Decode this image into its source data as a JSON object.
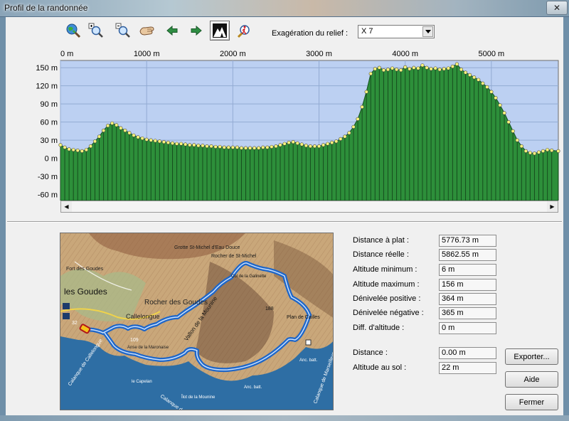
{
  "window": {
    "title": "Profil de la randonnée",
    "close_glyph": "✕"
  },
  "toolbar": {
    "icons": [
      "globe-search-icon",
      "zoom-in-icon",
      "zoom-out-icon",
      "hand-pan-icon",
      "arrow-left-icon",
      "arrow-right-icon",
      "terrain-icon",
      "hiker-icon"
    ],
    "exaggeration_label": "Exagération du relief :",
    "exaggeration_value": "X 7"
  },
  "chart_data": {
    "type": "area",
    "x_unit": "m",
    "x_ticks": [
      "0 m",
      "1000 m",
      "2000 m",
      "3000 m",
      "4000 m",
      "5000 m"
    ],
    "y_ticks": [
      "150 m",
      "120 m",
      "90 m",
      "60 m",
      "30 m",
      "0 m",
      "-30 m",
      "-60 m"
    ],
    "xlim": [
      0,
      5776.73
    ],
    "ylim": [
      -70,
      162
    ],
    "grid": true,
    "fill_color": "#2d8f3a",
    "point_color": "#fbf57c",
    "plot_background": "#bcd0f2",
    "distance_m": [
      0,
      50,
      100,
      150,
      200,
      250,
      300,
      350,
      400,
      450,
      500,
      550,
      600,
      650,
      700,
      750,
      800,
      850,
      900,
      950,
      1000,
      1050,
      1100,
      1150,
      1200,
      1250,
      1300,
      1350,
      1400,
      1450,
      1500,
      1550,
      1600,
      1650,
      1700,
      1750,
      1800,
      1850,
      1900,
      1950,
      2000,
      2050,
      2100,
      2150,
      2200,
      2250,
      2300,
      2350,
      2400,
      2450,
      2500,
      2550,
      2600,
      2650,
      2700,
      2750,
      2800,
      2850,
      2900,
      2950,
      3000,
      3050,
      3100,
      3150,
      3200,
      3250,
      3300,
      3350,
      3400,
      3450,
      3500,
      3550,
      3600,
      3650,
      3700,
      3750,
      3800,
      3850,
      3900,
      3950,
      4000,
      4050,
      4100,
      4150,
      4200,
      4250,
      4300,
      4350,
      4400,
      4450,
      4500,
      4550,
      4600,
      4650,
      4700,
      4750,
      4800,
      4850,
      4900,
      4950,
      5000,
      5050,
      5100,
      5150,
      5200,
      5250,
      5300,
      5350,
      5400,
      5450,
      5500,
      5550,
      5600,
      5650,
      5700,
      5776
    ],
    "altitude_m": [
      22,
      18,
      15,
      14,
      13,
      12,
      14,
      20,
      28,
      36,
      46,
      54,
      58,
      55,
      50,
      46,
      42,
      38,
      35,
      33,
      31,
      30,
      29,
      28,
      27,
      26,
      25,
      24,
      24,
      23,
      22,
      22,
      21,
      21,
      20,
      20,
      19,
      19,
      18,
      18,
      18,
      18,
      17,
      17,
      17,
      17,
      17,
      18,
      18,
      19,
      20,
      22,
      24,
      26,
      27,
      25,
      23,
      21,
      20,
      20,
      20,
      22,
      24,
      26,
      28,
      32,
      36,
      42,
      52,
      65,
      85,
      110,
      140,
      148,
      150,
      146,
      147,
      149,
      147,
      146,
      151,
      148,
      150,
      149,
      154,
      150,
      148,
      149,
      147,
      148,
      149,
      152,
      156,
      147,
      142,
      138,
      134,
      130,
      124,
      118,
      110,
      100,
      88,
      75,
      60,
      45,
      30,
      20,
      12,
      9,
      8,
      10,
      12,
      14,
      13,
      12
    ]
  },
  "map": {
    "labels": [
      "Grotte St-Michel d'Eau Douce",
      "Rocher de St-Michel",
      "les Goudes",
      "Rocher des Goudes",
      "Callelongue",
      "Anse de la Maronaise",
      "Vallon de la Mounine",
      "Plan de Cailles",
      "Col de la Galinette",
      "Anc. batt.",
      "Anc. batt.",
      "le Capelan",
      "Îlot de la Mounine",
      "Calanque de Callelongue",
      "Calanque de la Mounine",
      "Fort des Goudes",
      "Calanque de Marseilleveyre"
    ]
  },
  "stats": {
    "rows": [
      {
        "label": "Distance à plat :",
        "value": "5776.73 m"
      },
      {
        "label": "Distance réelle :",
        "value": "5862.55 m"
      },
      {
        "label": "Altitude minimum :",
        "value": "6 m"
      },
      {
        "label": "Altitude maximum :",
        "value": "156 m"
      },
      {
        "label": "Dénivelée positive :",
        "value": "364 m"
      },
      {
        "label": "Dénivelée négative :",
        "value": "365 m"
      },
      {
        "label": "Diff. d'altitude :",
        "value": "0 m"
      }
    ],
    "cursor": [
      {
        "label": "Distance :",
        "value": "0.00 m"
      },
      {
        "label": "Altitude au sol :",
        "value": "22 m"
      }
    ]
  },
  "buttons": {
    "export": "Exporter...",
    "help": "Aide",
    "close": "Fermer"
  }
}
